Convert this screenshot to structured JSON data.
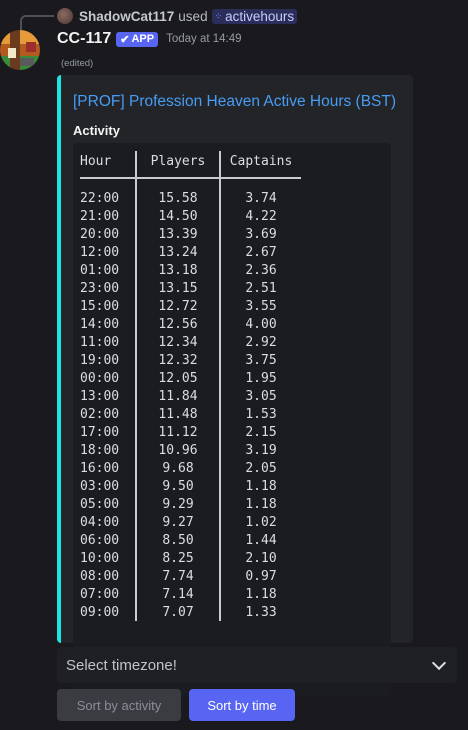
{
  "reply": {
    "username": "ShadowCat117",
    "used_text": "used",
    "command": "activehours"
  },
  "message": {
    "author": "CC-117",
    "badge": "APP",
    "timestamp": "Today at 14:49",
    "edited": "(edited)"
  },
  "embed": {
    "accent_color": "#1ee3e3",
    "title": "[PROF] Profession Heaven Active Hours (BST)",
    "field_name": "Activity",
    "columns": [
      "Hour",
      "Players",
      "Captains"
    ],
    "rows": [
      [
        "22:00",
        "15.58",
        "3.74"
      ],
      [
        "21:00",
        "14.50",
        "4.22"
      ],
      [
        "20:00",
        "13.39",
        "3.69"
      ],
      [
        "12:00",
        "13.24",
        "2.67"
      ],
      [
        "01:00",
        "13.18",
        "2.36"
      ],
      [
        "23:00",
        "13.15",
        "2.51"
      ],
      [
        "15:00",
        "12.72",
        "3.55"
      ],
      [
        "14:00",
        "12.56",
        "4.00"
      ],
      [
        "11:00",
        "12.34",
        "2.92"
      ],
      [
        "19:00",
        "12.32",
        "3.75"
      ],
      [
        "00:00",
        "12.05",
        "1.95"
      ],
      [
        "13:00",
        "11.84",
        "3.05"
      ],
      [
        "02:00",
        "11.48",
        "1.53"
      ],
      [
        "17:00",
        "11.12",
        "2.15"
      ],
      [
        "18:00",
        "10.96",
        "3.19"
      ],
      [
        "16:00",
        "9.68",
        "2.05"
      ],
      [
        "03:00",
        "9.50",
        "1.18"
      ],
      [
        "05:00",
        "9.29",
        "1.18"
      ],
      [
        "04:00",
        "9.27",
        "1.02"
      ],
      [
        "06:00",
        "8.50",
        "1.44"
      ],
      [
        "10:00",
        "8.25",
        "2.10"
      ],
      [
        "08:00",
        "7.74",
        "0.97"
      ],
      [
        "07:00",
        "7.14",
        "1.18"
      ],
      [
        "09:00",
        "7.07",
        "1.33"
      ]
    ]
  },
  "timezone_select": {
    "placeholder": "Select timezone!"
  },
  "buttons": {
    "sort_activity": "Sort by activity",
    "sort_time": "Sort by time"
  },
  "colors": {
    "background": "#1a1a1e",
    "embed_bg": "#232428",
    "link": "#479cf4",
    "brand": "#5865f2"
  }
}
